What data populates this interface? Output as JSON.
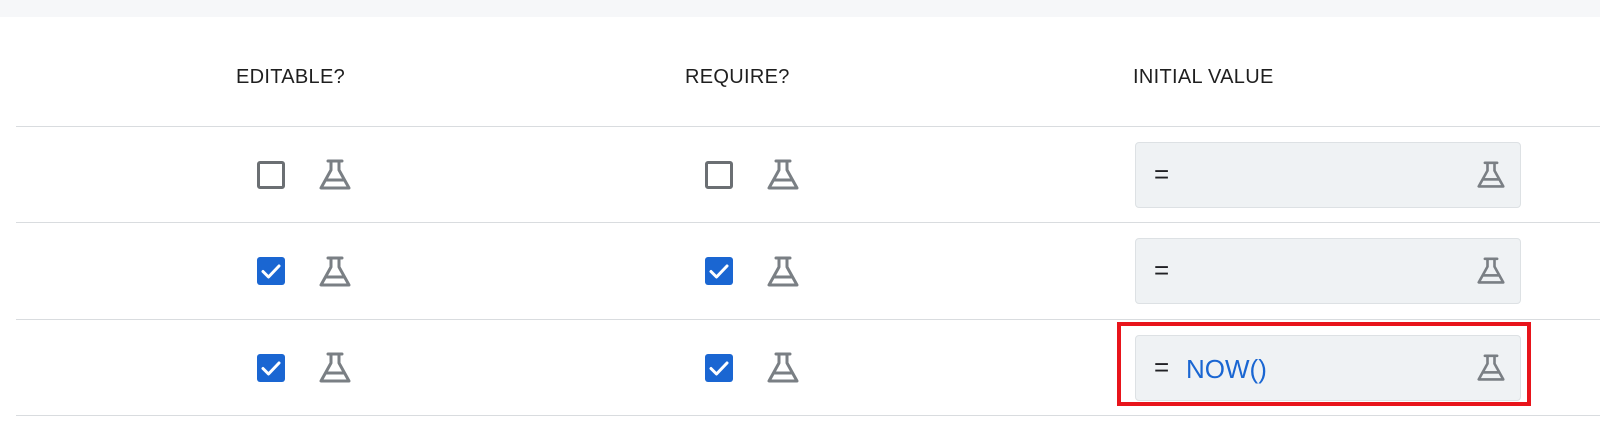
{
  "columns": {
    "editable": "EDITABLE?",
    "require": "REQUIRE?",
    "initial_value": "INITIAL VALUE"
  },
  "rows": [
    {
      "editable_checked": false,
      "require_checked": false,
      "initial_value": {
        "prefix": "=",
        "expression": ""
      }
    },
    {
      "editable_checked": true,
      "require_checked": true,
      "initial_value": {
        "prefix": "=",
        "expression": ""
      }
    },
    {
      "editable_checked": true,
      "require_checked": true,
      "initial_value": {
        "prefix": "=",
        "expression": "NOW()"
      }
    }
  ],
  "icons": {
    "formula": "flask-icon",
    "check": "checkmark-icon"
  },
  "colors": {
    "checkbox_checked": "#1a66d2",
    "expression_text": "#1a66d2",
    "highlight_border": "#e8141b",
    "field_background": "#eff2f4"
  }
}
